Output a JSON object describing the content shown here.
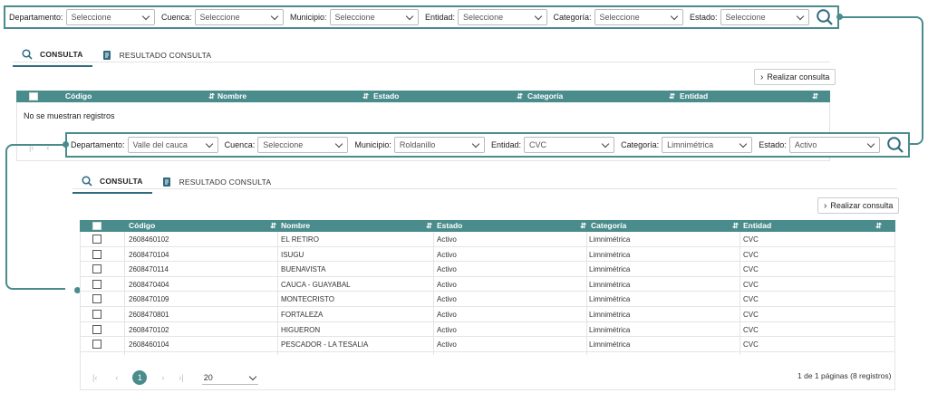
{
  "top_filters": {
    "departamento": {
      "label": "Departamento:",
      "value": "Seleccione"
    },
    "cuenca": {
      "label": "Cuenca:",
      "value": "Seleccione"
    },
    "municipio": {
      "label": "Municipio:",
      "value": "Seleccione"
    },
    "entidad": {
      "label": "Entidad:",
      "value": "Seleccione"
    },
    "categoria": {
      "label": "Categoría:",
      "value": "Seleccione"
    },
    "estado": {
      "label": "Estado:",
      "value": "Seleccione"
    }
  },
  "bottom_filters": {
    "departamento": {
      "label": "Departamento:",
      "value": "Valle del cauca"
    },
    "cuenca": {
      "label": "Cuenca:",
      "value": "Seleccione"
    },
    "municipio": {
      "label": "Municipio:",
      "value": "Roldanillo"
    },
    "entidad": {
      "label": "Entidad:",
      "value": "CVC"
    },
    "categoria": {
      "label": "Categoría:",
      "value": "Limnimétrica"
    },
    "estado": {
      "label": "Estado:",
      "value": "Activo"
    }
  },
  "tabs": {
    "consulta": "CONSULTA",
    "resultado": "RESULTADO CONSULTA"
  },
  "realizar_consulta": "Realizar consulta",
  "columns": {
    "codigo": "Código",
    "nombre": "Nombre",
    "estado": "Estado",
    "categoria": "Categoría",
    "entidad": "Entidad"
  },
  "empty_message": "No se muestran registros",
  "rows": [
    {
      "codigo": "2608460102",
      "nombre": "EL RETIRO",
      "estado": "Activo",
      "categoria": "Limnimétrica",
      "entidad": "CVC"
    },
    {
      "codigo": "2608470104",
      "nombre": "ISUGU",
      "estado": "Activo",
      "categoria": "Limnimétrica",
      "entidad": "CVC"
    },
    {
      "codigo": "2608470114",
      "nombre": "BUENAVISTA",
      "estado": "Activo",
      "categoria": "Limnimétrica",
      "entidad": "CVC"
    },
    {
      "codigo": "2608470404",
      "nombre": "CAUCA - GUAYABAL",
      "estado": "Activo",
      "categoria": "Limnimétrica",
      "entidad": "CVC"
    },
    {
      "codigo": "2608470109",
      "nombre": "MONTECRISTO",
      "estado": "Activo",
      "categoria": "Limnimétrica",
      "entidad": "CVC"
    },
    {
      "codigo": "2608470801",
      "nombre": "FORTALEZA",
      "estado": "Activo",
      "categoria": "Limnimétrica",
      "entidad": "CVC"
    },
    {
      "codigo": "2608470102",
      "nombre": "HIGUERON",
      "estado": "Activo",
      "categoria": "Limnimétrica",
      "entidad": "CVC"
    },
    {
      "codigo": "2608460104",
      "nombre": "PESCADOR - LA TESALIA",
      "estado": "Activo",
      "categoria": "Limnimétrica",
      "entidad": "CVC"
    }
  ],
  "pagination": {
    "current_page": "1",
    "page_size": "20",
    "summary": "1 de 1 páginas (8 registros)"
  },
  "colors": {
    "accent": "#4a8c8c",
    "tab_underline": "#2f6a80"
  },
  "icons": [
    "search-icon",
    "document-icon",
    "chevron-down-icon",
    "chevron-right-icon",
    "filter-icon",
    "first-page-icon",
    "prev-page-icon",
    "next-page-icon",
    "last-page-icon"
  ]
}
